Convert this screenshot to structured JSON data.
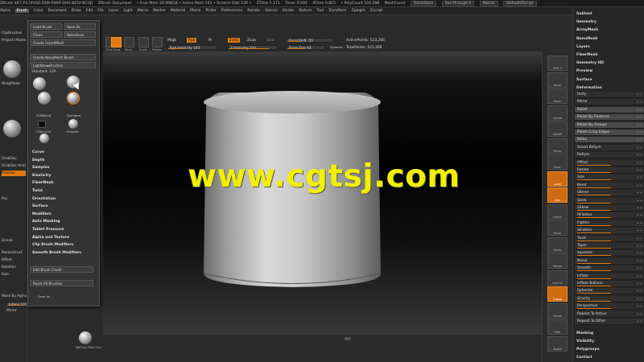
{
  "title_bar": {
    "items": [
      "ZBrush 4R7 P3 [4VQZ-Z4M-P4NP-QHG-8ZGI-NCHJ]",
      "ZBrush Document",
      "• Free Mem 26.998GB • Active Mem 531 • Scratch Disk 126 •",
      "ZTime 1.171",
      "Timer 0.091",
      "ATime 0.815",
      "• PolyCount 524.288",
      "MeshCount"
    ],
    "quicksave": "QuickSave",
    "seethrough": "See-through 0",
    "menus_label": "Menus",
    "script": "DefaultZScript"
  },
  "menu_bar": {
    "items": [
      "Alpha",
      "Brush",
      "Color",
      "Document",
      "Draw",
      "Edit",
      "File",
      "Layer",
      "Light",
      "Macro",
      "Marker",
      "Material",
      "Movie",
      "Picker",
      "Preferences",
      "Render",
      "Stencil",
      "Stroke",
      "Texture",
      "Tool",
      "Transform",
      "Zplugin",
      "Zscript"
    ],
    "active": "Brush"
  },
  "toolbar": {
    "edit": "Edit",
    "draw": "Draw",
    "move": "Move",
    "scale": "Scale",
    "rotate": "Rotate",
    "mrgb": "Mrgb",
    "rgb": "Rgb",
    "m": "M",
    "rgb_intensity": "Rgb Intensity 100",
    "zadd": "Zadd",
    "zsub": "Zsub",
    "zcut": "Zcut",
    "z_intensity": "Z Intensity 100",
    "focal_shift": "Focal Shift -55",
    "draw_size": "Draw Size 64",
    "dynamic": "Dynamic",
    "active_points": "ActivePoints: 523,266",
    "total_points": "TotalPoints: 523,266"
  },
  "left_panel": {
    "items": [
      "ClipBrushes",
      "Projecti Master",
      "WrapMode",
      "GrabDoc",
      "GrabDoc AndUse",
      "Preview",
      "Pro",
      "Divide",
      "Reconstruct",
      "Offset",
      "Rotation",
      "Size"
    ],
    "lower": [
      "Mask By Alpha",
      "Intens 100",
      "Blend 100",
      "Mirror"
    ]
  },
  "brush_popup": {
    "load_brush": "Load Brush",
    "save_as": "Save As",
    "clone": "Clone",
    "select_icon": "SelectIcon",
    "create_insertmesh": "Create InsertMesh",
    "create_nanomesh": "Create NanoMesh Brush",
    "lightbox_brushes": "Lightbox▸Brushes",
    "standard": "Standard. 126",
    "thumbs": [
      "MoveTop",
      "Standard",
      "SoftBlend",
      "Smooth",
      "ClipCurve",
      "Rotate"
    ],
    "thumb_labels": [
      "Standard",
      "MoveTop",
      "SoftBlend",
      "Smooth",
      "ClipCurve"
    ],
    "sections": [
      "Curve",
      "Depth",
      "Samples",
      "Elasticity",
      "FiberMesh",
      "Twist",
      "Orientation",
      "Surface",
      "Modifiers",
      "Auto Masking",
      "Tablet Pressure",
      "Alpha and Texture",
      "Clip Brush Modifiers",
      "Smooth Brush Modifiers"
    ],
    "edit_brush_credit": "Edit Brush Credit",
    "reset_all": "Reset All Brushes",
    "save_as_bottom": "Save As"
  },
  "right_shelf": {
    "buttons": [
      "SPix 3",
      "Scroll",
      "Zoom",
      "Actual",
      "AAHalf",
      "Persp",
      "Floor",
      "Local",
      "Sym",
      "Frame",
      "Move",
      "Scale",
      "Rotate",
      "Line Fill PolyF",
      "Transp",
      "Ghost",
      "Solo",
      "Xpose"
    ]
  },
  "right_panel": {
    "top": [
      "Subtool",
      "Geometry",
      "ArrayMesh",
      "NanoMesh",
      "Layers",
      "FiberMesh",
      "Geometry HD",
      "Preview",
      "Surface",
      "Deformation"
    ],
    "deform": [
      "Unify",
      "Mirror",
      "Polish",
      "Polish By Features",
      "Polish By Groups",
      "Polish Crisp Edges",
      "Relax",
      "Smart ReSym",
      "ReSym",
      "Offset",
      "Rotate",
      "Size",
      "Bend",
      "SBend",
      "Skew",
      "SSkew",
      "RFlatten",
      "Flatten",
      "SFlatten",
      "Twist",
      "Taper",
      "Squeeze",
      "Noise",
      "Smooth",
      "Inflate",
      "Inflate Balloon",
      "Spherize",
      "Gravity",
      "Perspective",
      "Repeat To Active",
      "Repeat To Other"
    ],
    "bottom": [
      "Masking",
      "Visibility",
      "Polygroups",
      "Contact"
    ]
  },
  "bottom_bar": {
    "matcap": "MatCap Pearl Cav"
  },
  "watermark": "www.cgtsj.com",
  "colors": {
    "accent": "#e07a10",
    "watermark": "#f0f000",
    "panel": "#2a2a2a"
  }
}
